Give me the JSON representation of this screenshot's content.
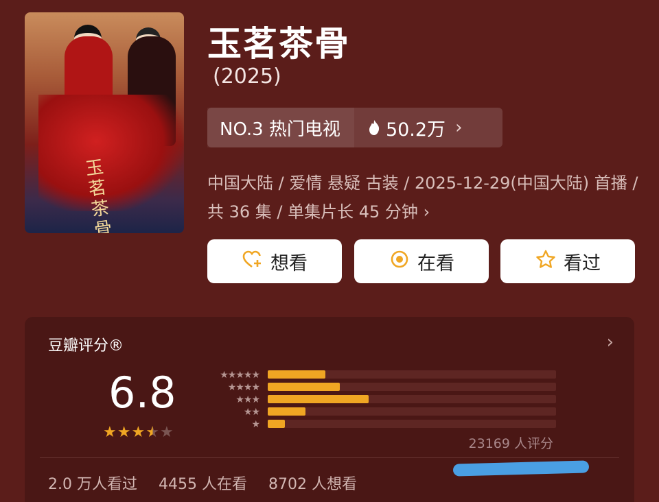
{
  "show": {
    "title": "玉茗茶骨",
    "year": "(2025)",
    "poster_calligraphy": "玉茗茶骨"
  },
  "ranking": {
    "label": "NO.3 热门电视",
    "heat": "50.2万",
    "heat_icon": "flame-icon",
    "chevron": "›"
  },
  "meta": {
    "line": "中国大陆 / 爱情 悬疑 古装 / 2025-12-29(中国大陆) 首播 / 共 36 集 / 单集片长 45 分钟"
  },
  "actions": [
    {
      "label": "想看",
      "icon": "heart-plus-icon"
    },
    {
      "label": "在看",
      "icon": "watching-icon"
    },
    {
      "label": "看过",
      "icon": "star-outline-icon"
    }
  ],
  "rating": {
    "title": "豆瓣评分®",
    "score": "6.8",
    "stars_out_of_5": 3.5,
    "count_label": "23169 人评分",
    "distribution_fraction": [
      0.2,
      0.25,
      0.35,
      0.13,
      0.06
    ],
    "star_rows": [
      "★★★★★",
      "★★★★",
      "★★★",
      "★★",
      "★"
    ],
    "stats": [
      "2.0 万人看过",
      "4455 人在看",
      "8702 人想看"
    ]
  },
  "colors": {
    "accent": "#f0a623",
    "background": "#5b1d1a",
    "card": "#4a1715",
    "annotation_blue": "#4a9fe3"
  }
}
